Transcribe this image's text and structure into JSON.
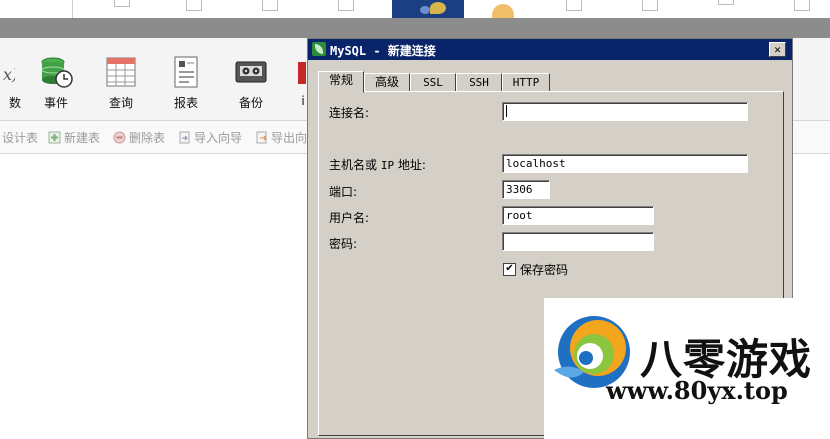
{
  "toolbar": {
    "partial_left_label": "数",
    "partial_right_label": "i",
    "buttons": [
      {
        "label": "事件"
      },
      {
        "label": "查询"
      },
      {
        "label": "报表"
      },
      {
        "label": "备份"
      }
    ]
  },
  "subbar": {
    "items": [
      {
        "label": "设计表"
      },
      {
        "label": "新建表"
      },
      {
        "label": "删除表"
      },
      {
        "label": "导入向导"
      },
      {
        "label": "导出向"
      }
    ]
  },
  "dialog": {
    "title": "MySQL - 新建连接",
    "close_glyph": "✕",
    "tabs": [
      {
        "label": "常规",
        "active": true
      },
      {
        "label": "高级",
        "active": false
      },
      {
        "label": "SSL",
        "active": false
      },
      {
        "label": "SSH",
        "active": false
      },
      {
        "label": "HTTP",
        "active": false
      }
    ],
    "fields": {
      "connection_name": {
        "label": "连接名:",
        "value": ""
      },
      "host": {
        "label_prefix": "主机名或 ",
        "label_mono": "IP",
        "label_suffix": " 地址:",
        "value": "localhost"
      },
      "port": {
        "label": "端口:",
        "value": "3306"
      },
      "username": {
        "label": "用户名:",
        "value": "root"
      },
      "password": {
        "label": "密码:",
        "value": ""
      },
      "save_password": {
        "label": "保存密码",
        "checked": true,
        "glyph": "✔"
      }
    }
  },
  "watermark": {
    "brand": "八零游戏",
    "url": "www.80yx.top"
  },
  "colors": {
    "title_bar": "#0a246a",
    "dialog_bg": "#d4d0c8",
    "main_band": "#8c8c8c"
  }
}
